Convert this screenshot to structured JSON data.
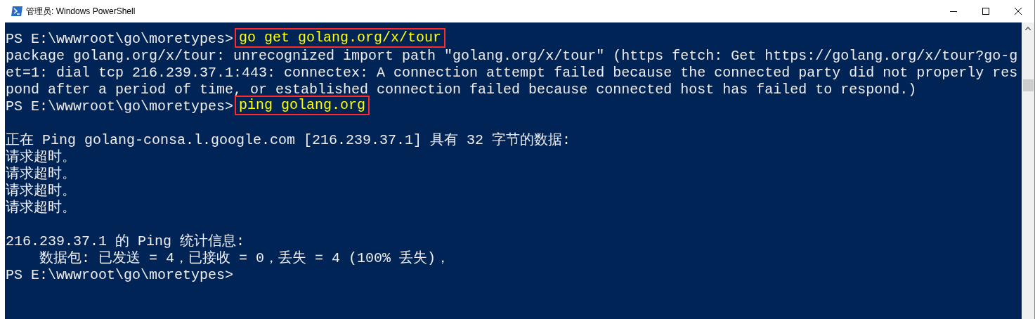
{
  "window": {
    "title": "管理员: Windows PowerShell"
  },
  "console_lines": [
    {
      "kind": "prompt",
      "prompt": "PS E:\\wwwroot\\go\\moretypes>",
      "command": "go get golang.org/x/tour",
      "highlighted": true
    },
    {
      "kind": "output",
      "text": "package golang.org/x/tour: unrecognized import path \"golang.org/x/tour\" (https fetch: Get https://golang.org/x/tour?go-g"
    },
    {
      "kind": "output",
      "text": "et=1: dial tcp 216.239.37.1:443: connectex: A connection attempt failed because the connected party did not properly res"
    },
    {
      "kind": "output",
      "text": "pond after a period of time, or established connection failed because connected host has failed to respond.)"
    },
    {
      "kind": "prompt",
      "prompt": "PS E:\\wwwroot\\go\\moretypes>",
      "command": "ping golang.org",
      "highlighted": true
    },
    {
      "kind": "blank"
    },
    {
      "kind": "output",
      "text": "正在 Ping golang-consa.l.google.com [216.239.37.1] 具有 32 字节的数据:"
    },
    {
      "kind": "output",
      "text": "请求超时。"
    },
    {
      "kind": "output",
      "text": "请求超时。"
    },
    {
      "kind": "output",
      "text": "请求超时。"
    },
    {
      "kind": "output",
      "text": "请求超时。"
    },
    {
      "kind": "blank"
    },
    {
      "kind": "output",
      "text": "216.239.37.1 的 Ping 统计信息:"
    },
    {
      "kind": "output",
      "text": "    数据包: 已发送 = 4，已接收 = 0，丢失 = 4 (100% 丢失)，"
    },
    {
      "kind": "prompt",
      "prompt": "PS E:\\wwwroot\\go\\moretypes>"
    }
  ]
}
